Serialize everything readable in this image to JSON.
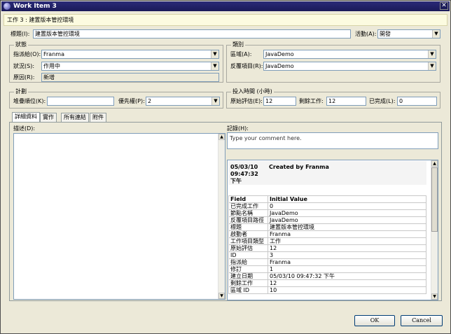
{
  "window": {
    "title": "Work Item 3",
    "close_glyph": "✕"
  },
  "header": {
    "text": "工作 3 : 建置版本管控環境"
  },
  "title_row": {
    "title_label": "標題(I):",
    "title_value": "建置版本管控環境",
    "activity_label": "活動(A):",
    "activity_value": "開發"
  },
  "status": {
    "group_label": "狀態",
    "assigned_label": "指派給(O):",
    "assigned_value": "Franma",
    "state_label": "狀況(S):",
    "state_value": "作用中",
    "reason_label": "原因(R):",
    "reason_value": "新增"
  },
  "classification": {
    "group_label": "類別",
    "area_label": "區域(A):",
    "area_value": "JavaDemo",
    "iteration_label": "反覆項目(R):",
    "iteration_value": "JavaDemo"
  },
  "planning": {
    "group_label": "計劃",
    "stack_rank_label": "堆疊順位(K):",
    "stack_rank_value": "",
    "priority_label": "優先權(P):",
    "priority_value": "2"
  },
  "effort": {
    "group_label": "投入時間 (小時)",
    "original_label": "原始評估(E):",
    "original_value": "12",
    "remaining_label": "剩餘工作:",
    "remaining_value": "12",
    "completed_label": "已完成(L):",
    "completed_value": "0"
  },
  "tabs": [
    {
      "label": "詳細資料"
    },
    {
      "label": "實作"
    },
    {
      "label": "所有連結"
    },
    {
      "label": "附件"
    }
  ],
  "details": {
    "description_label": "描述(D):",
    "history_label": "記錄(H):",
    "comment_placeholder": "Type your comment here.",
    "history_date": "05/03/10 09:47:32 下午",
    "history_created_by": "Created by Franma",
    "field_header": "Field",
    "value_header": "Initial Value",
    "rows": [
      {
        "field": "已完成工作",
        "value": "0"
      },
      {
        "field": "節點名稱",
        "value": "JavaDemo"
      },
      {
        "field": "反覆項目路徑",
        "value": "JavaDemo"
      },
      {
        "field": "標題",
        "value": "建置版本管控環境"
      },
      {
        "field": "啟動者",
        "value": "Franma"
      },
      {
        "field": "工作項目類型",
        "value": "工作"
      },
      {
        "field": "原始評估",
        "value": "12"
      },
      {
        "field": "ID",
        "value": "3"
      },
      {
        "field": "指派給",
        "value": "Franma"
      },
      {
        "field": "修訂",
        "value": "1"
      },
      {
        "field": "建立日期",
        "value": "05/03/10 09:47:32 下午"
      },
      {
        "field": "剩餘工作",
        "value": "12"
      },
      {
        "field": "區域 ID",
        "value": "10"
      }
    ]
  },
  "buttons": {
    "ok": "OK",
    "cancel": "Cancel"
  }
}
